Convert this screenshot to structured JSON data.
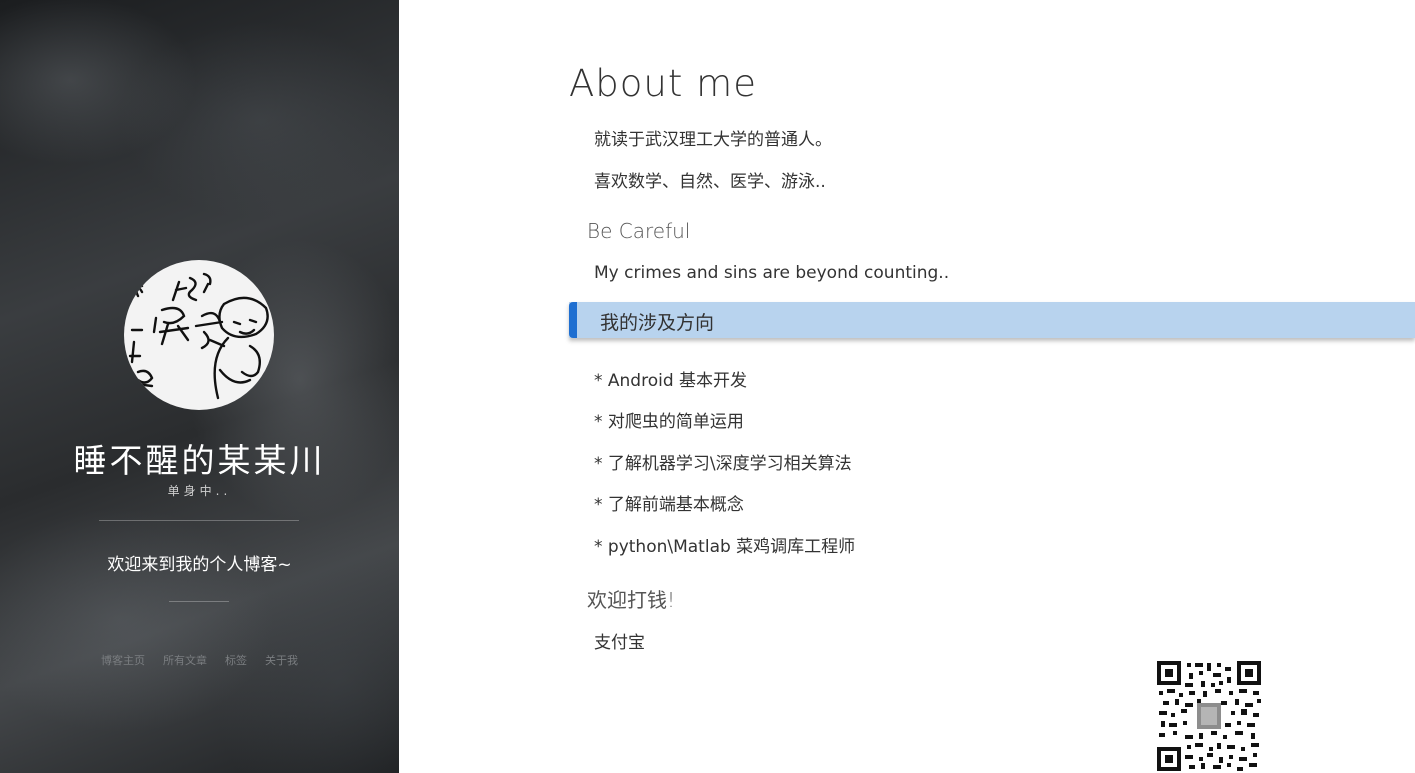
{
  "sidebar": {
    "avatar_alt": "avatar",
    "site_name": "睡不醒的某某川",
    "site_subtitle": "单身中..",
    "welcome": "欢迎来到我的个人博客~",
    "nav": [
      "博客主页",
      "所有文章",
      "标签",
      "关于我"
    ]
  },
  "main": {
    "title": "About me",
    "intro": [
      "就读于武汉理工大学的普通人。",
      "喜欢数学、自然、医学、游泳.."
    ],
    "careful_heading": "Be Careful",
    "careful_text": "My crimes and sins are beyond counting..",
    "direction_heading": "我的涉及方向",
    "directions": [
      "* Android 基本开发",
      "* 对爬虫的简单运用",
      "* 了解机器学习\\深度学习相关算法",
      "* 了解前端基本概念",
      "* python\\Matlab 菜鸡调库工程师"
    ],
    "donate_heading": "欢迎打钱!",
    "alipay_label": "支付宝"
  },
  "colors": {
    "section_bar": "#b8d3ee",
    "section_accent": "#1f6fd1"
  }
}
